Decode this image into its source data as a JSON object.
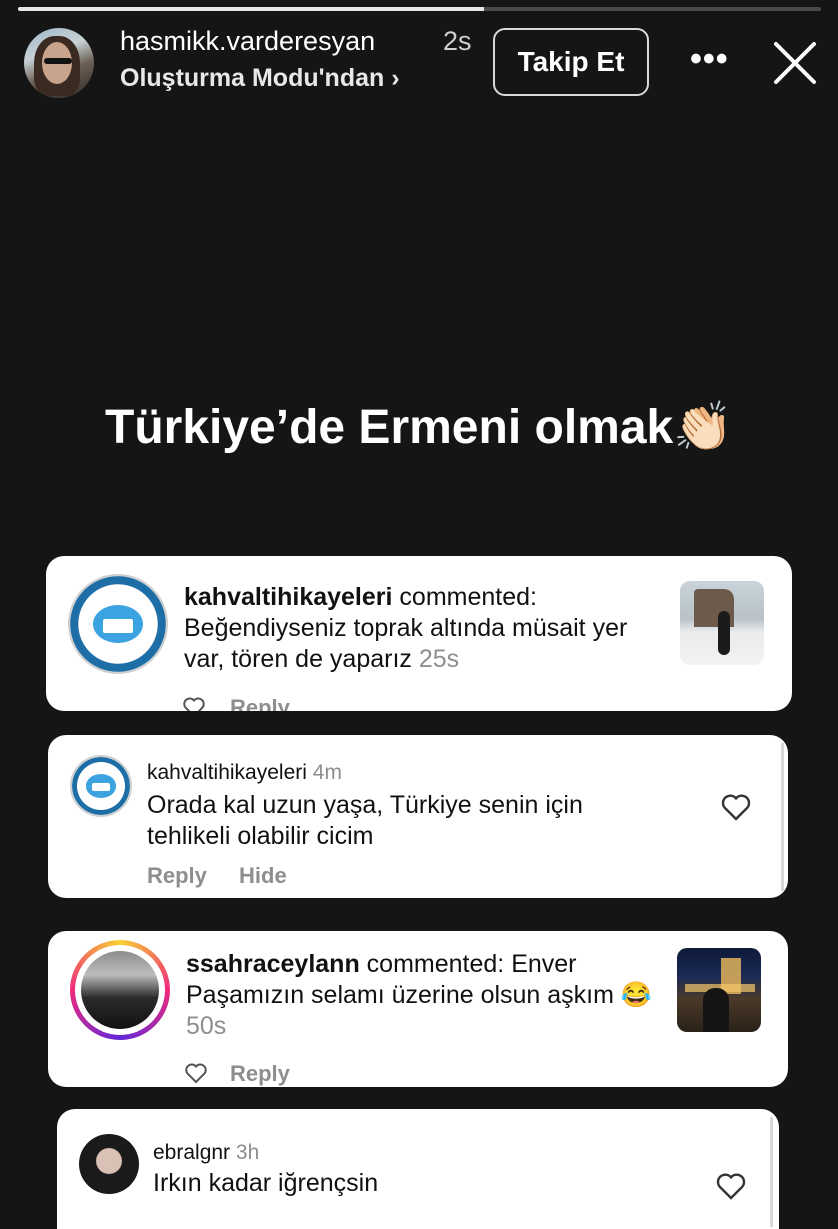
{
  "story": {
    "progress": 0.58,
    "username": "hasmikk.varderesyan",
    "time": "2s",
    "source": "Oluşturma Modu'ndan ›",
    "follow_label": "Takip Et",
    "more_label": "•••",
    "headline": "Türkiye’de Ermeni olmak👏🏻"
  },
  "comments": [
    {
      "user": "kahvaltihikayeleri",
      "verb": "commented:",
      "text": "Beğendiyseniz toprak altında müsait yer var, tören de yaparız",
      "time": "25s",
      "reply": "Reply"
    },
    {
      "user": "kahvaltihikayeleri",
      "time": "4m",
      "text_line1": "Orada kal uzun yaşa, Türkiye senin için",
      "text_line2": "tehlikeli olabilir cicim",
      "reply": "Reply",
      "hide": "Hide"
    },
    {
      "user": "ssahraceylann",
      "verb": "commented:",
      "text_a": "Enver",
      "text_b": "Paşamızın selamı üzerine olsun aşkım",
      "emoji": "😂",
      "time": "50s",
      "reply": "Reply"
    },
    {
      "user": "ebralgnr",
      "time": "3h",
      "text": "Irkın kadar iğrençsin"
    }
  ]
}
